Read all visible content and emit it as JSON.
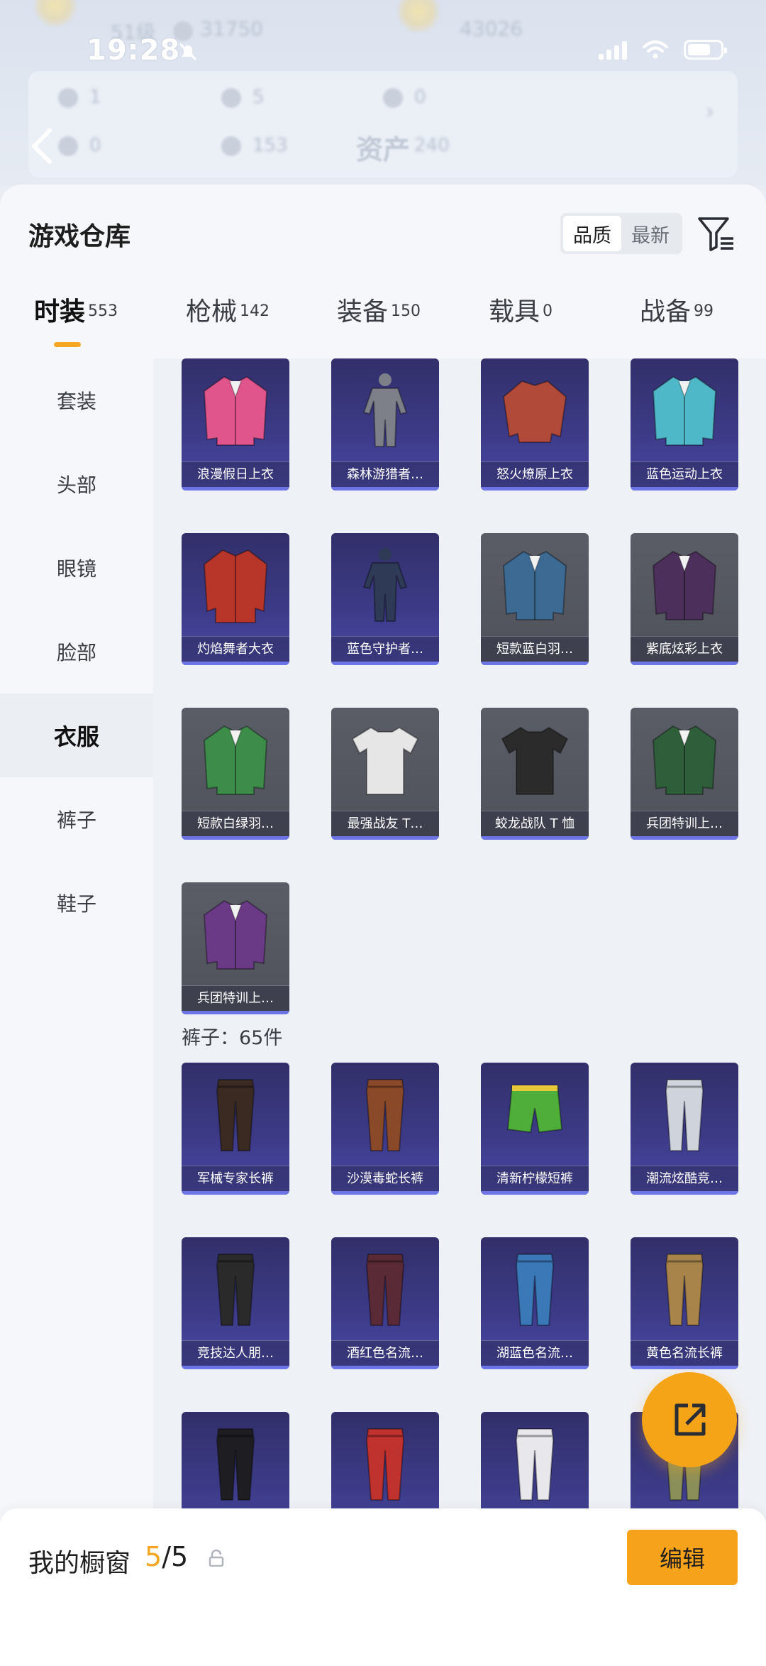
{
  "status_bar": {
    "time": "19:28"
  },
  "background": {
    "level": "51级",
    "coins": "31750",
    "score": "43026",
    "stats_row1": [
      "1",
      "5",
      "0"
    ],
    "stats_row2": [
      "0",
      "153",
      "240"
    ],
    "nav_title": "资产"
  },
  "header": {
    "title": "游戏仓库",
    "sort": {
      "options": [
        "品质",
        "最新"
      ],
      "active": 0
    },
    "filter_icon": "filter-icon"
  },
  "tabs": [
    {
      "label": "时装",
      "count": "553",
      "active": true
    },
    {
      "label": "枪械",
      "count": "142"
    },
    {
      "label": "装备",
      "count": "150"
    },
    {
      "label": "载具",
      "count": "0"
    },
    {
      "label": "战备",
      "count": "99"
    }
  ],
  "sidebar": {
    "items": [
      "套装",
      "头部",
      "眼镜",
      "脸部",
      "衣服",
      "裤子",
      "鞋子"
    ],
    "active": 4
  },
  "clothes": [
    {
      "name": "浪漫假日上衣",
      "rarity": "purple",
      "color": "#e0558c",
      "kind": "jacket"
    },
    {
      "name": "森林游猎者…",
      "rarity": "purple",
      "color": "#7d8088",
      "kind": "suit"
    },
    {
      "name": "怒火燎原上衣",
      "rarity": "purple",
      "color": "#b24a3a",
      "kind": "sweater"
    },
    {
      "name": "蓝色运动上衣",
      "rarity": "purple",
      "color": "#4fb8c8",
      "kind": "jacket"
    },
    {
      "name": "灼焰舞者大衣",
      "rarity": "purple",
      "color": "#b8352a",
      "kind": "coat"
    },
    {
      "name": "蓝色守护者…",
      "rarity": "purple",
      "color": "#2f3a56",
      "kind": "suit"
    },
    {
      "name": "短款蓝白羽…",
      "rarity": "gray",
      "color": "#3d6a93",
      "kind": "jacket"
    },
    {
      "name": "紫底炫彩上衣",
      "rarity": "gray",
      "color": "#4d2f5c",
      "kind": "jacket"
    },
    {
      "name": "短款白绿羽…",
      "rarity": "gray",
      "color": "#3d8c4a",
      "kind": "jacket"
    },
    {
      "name": "最强战友 T…",
      "rarity": "gray",
      "color": "#e6e6e6",
      "kind": "tshirt"
    },
    {
      "name": "蛟龙战队 T 恤",
      "rarity": "gray",
      "color": "#2b2b2b",
      "kind": "tshirt"
    },
    {
      "name": "兵团特训上…",
      "rarity": "gray",
      "color": "#2f5e3a",
      "kind": "jacket"
    },
    {
      "name": "兵团特训上…",
      "rarity": "gray",
      "color": "#6b3a86",
      "kind": "jacket"
    }
  ],
  "pants_section": {
    "heading": "裤子：65件"
  },
  "pants": [
    {
      "name": "军械专家长裤",
      "rarity": "purple",
      "color": "#3a2a22"
    },
    {
      "name": "沙漠毒蛇长裤",
      "rarity": "purple",
      "color": "#8a4a2a"
    },
    {
      "name": "清新柠檬短裤",
      "rarity": "purple",
      "color": "#4fae3a",
      "kind": "shorts"
    },
    {
      "name": "潮流炫酷竞…",
      "rarity": "purple",
      "color": "#cfd4dc"
    },
    {
      "name": "竞技达人朋…",
      "rarity": "purple",
      "color": "#2a2a2a"
    },
    {
      "name": "酒红色名流…",
      "rarity": "purple",
      "color": "#5a2a36"
    },
    {
      "name": "湖蓝色名流…",
      "rarity": "purple",
      "color": "#3a78b8"
    },
    {
      "name": "黄色名流长裤",
      "rarity": "purple",
      "color": "#a8844a"
    },
    {
      "name": "",
      "rarity": "purple",
      "color": "#1e1e22"
    },
    {
      "name": "",
      "rarity": "purple",
      "color": "#c0322e"
    },
    {
      "name": "",
      "rarity": "purple",
      "color": "#e8e8ec"
    },
    {
      "name": "",
      "rarity": "purple",
      "color": "#8a8f5a"
    }
  ],
  "bottom_bar": {
    "label": "我的橱窗",
    "current": "5",
    "total": "/5",
    "edit_label": "编辑"
  },
  "accent": "#f5a623"
}
